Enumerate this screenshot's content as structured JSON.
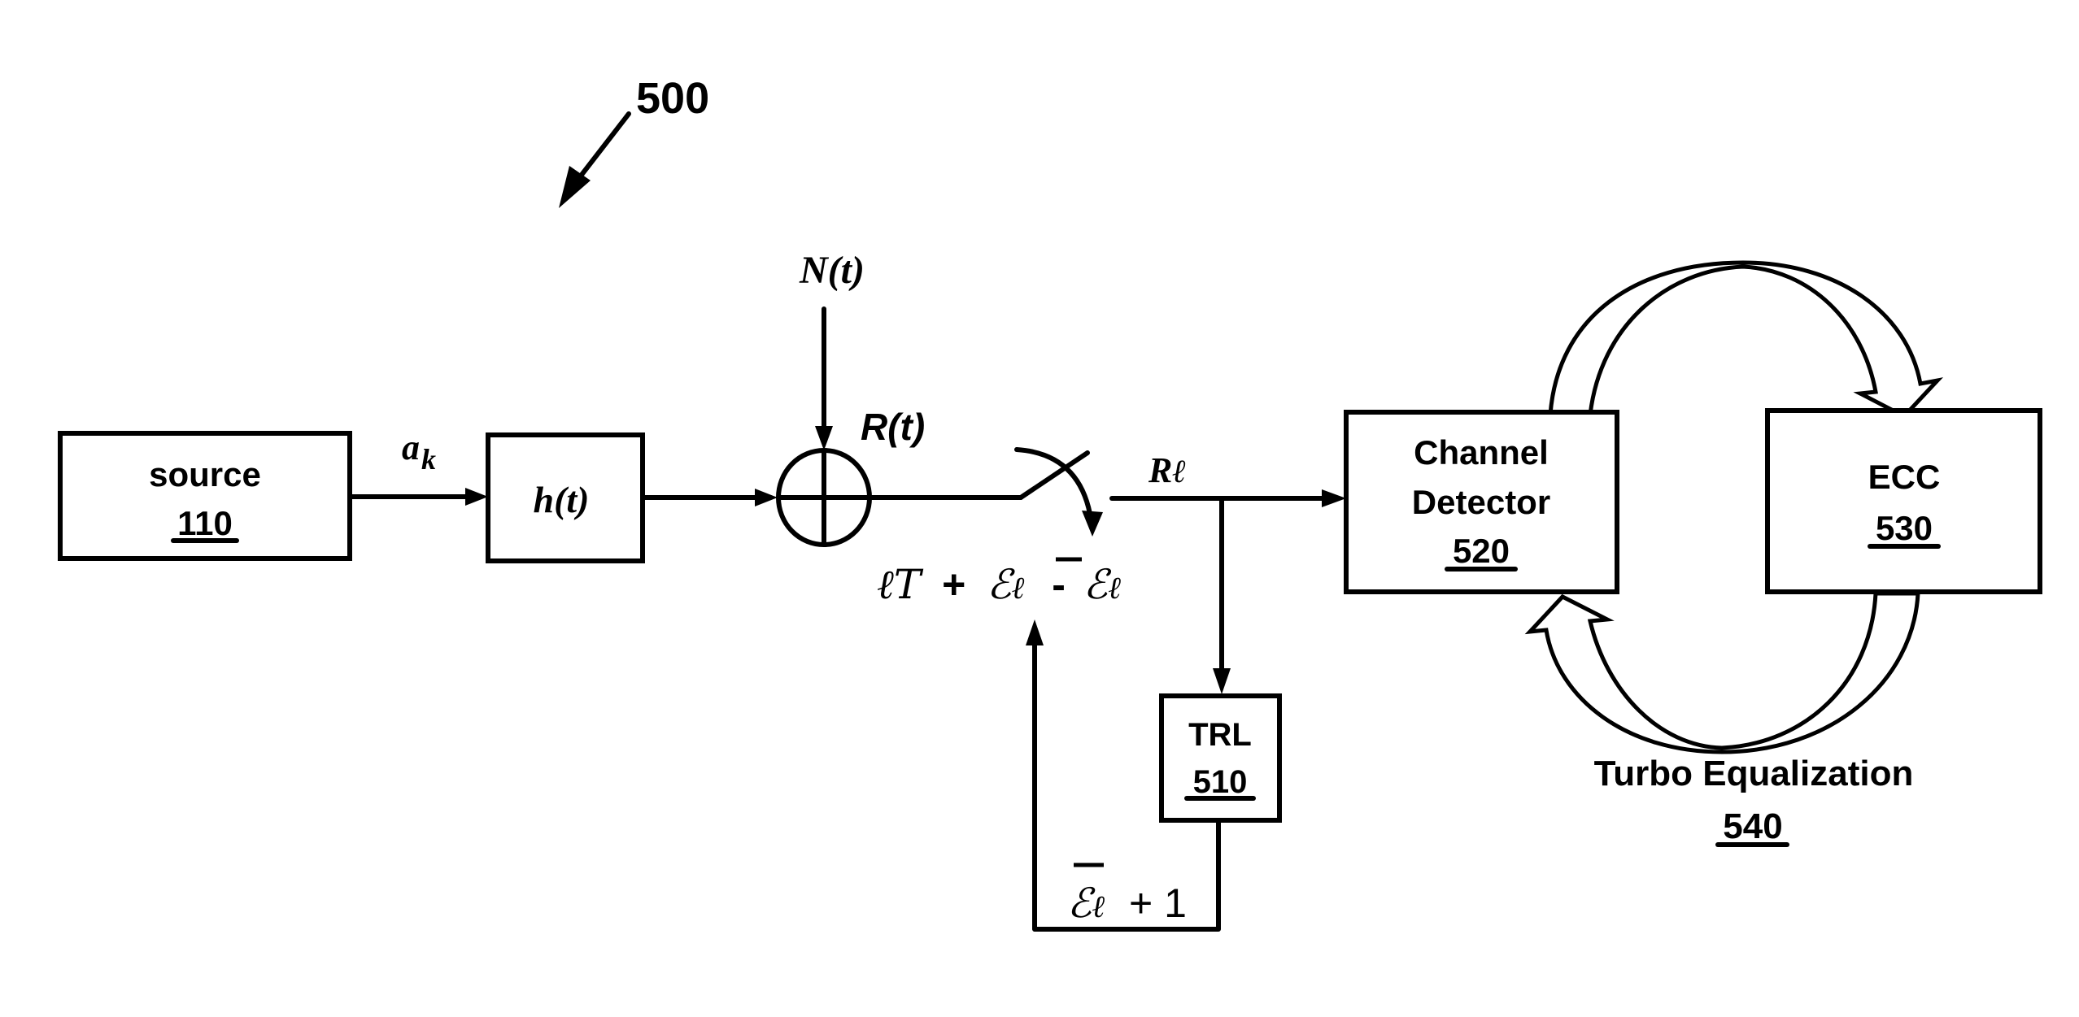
{
  "figure": {
    "reference_label": "500",
    "colors": {
      "ink": "#000000",
      "background": "#ffffff"
    }
  },
  "blocks": {
    "source": {
      "title": "source",
      "ref": "110"
    },
    "channel_filter": {
      "title": "h(t)"
    },
    "trl": {
      "title": "TRL",
      "ref": "510"
    },
    "channel_detector": {
      "title_line1": "Channel",
      "title_line2": "Detector",
      "ref": "520"
    },
    "ecc": {
      "title": "ECC",
      "ref": "530"
    }
  },
  "summer": {
    "symbol": "adder"
  },
  "signals": {
    "symbols": {
      "base": "a",
      "subscript": "k"
    },
    "noise": "N(t)",
    "received": "R(t)",
    "sampled": {
      "base": "R",
      "subscript": "ℓ"
    },
    "sampling_instant": {
      "part1": "ℓT",
      "plus": "+",
      "eps": "ℰ",
      "eps_sub": "ℓ",
      "minus": "-",
      "eps_bar": "ℰ",
      "eps_bar_sub": "ℓ"
    },
    "feedback": {
      "eps_bar": "ℰ",
      "eps_bar_sub": "ℓ",
      "suffix": "+ 1"
    }
  },
  "loop": {
    "title": "Turbo Equalization",
    "ref": "540"
  }
}
